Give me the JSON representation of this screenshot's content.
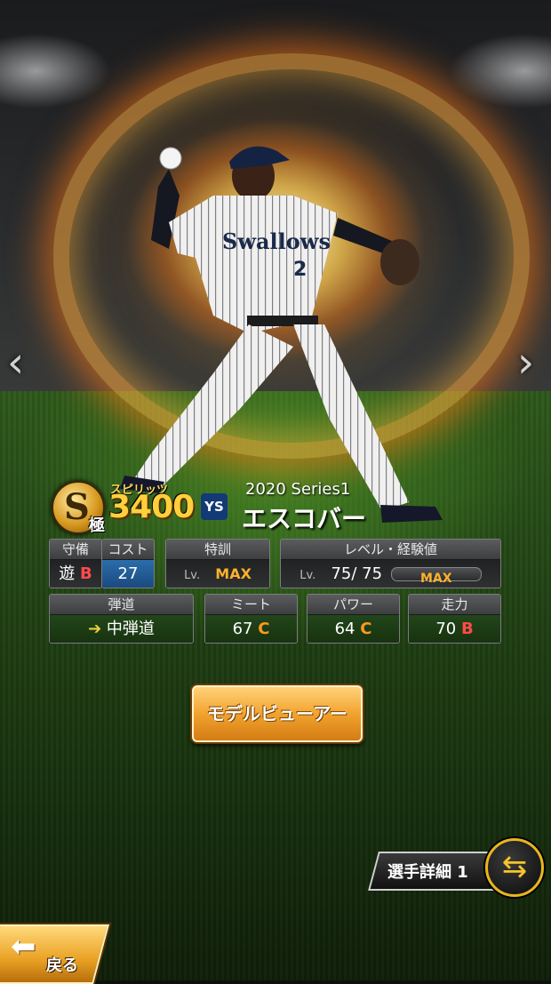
{
  "player": {
    "series": "2020 Series1",
    "name": "エスコバー",
    "jersey_text": "Swallows",
    "jersey_number": "2",
    "team_logo": "YS"
  },
  "rank": {
    "letter": "S",
    "tier": "極"
  },
  "spirits": {
    "label": "スピリッツ",
    "value": "3400"
  },
  "nav": {
    "prev_arrow": "‹",
    "next_arrow": "›"
  },
  "stats": {
    "defense": {
      "label": "守備",
      "position": "遊",
      "grade": "B"
    },
    "cost": {
      "label": "コスト",
      "value": "27"
    },
    "training": {
      "label": "特訓",
      "lv": "Lv.",
      "value": "MAX"
    },
    "level": {
      "label": "レベル・経験値",
      "lv": "Lv.",
      "current": "75",
      "sep": "/",
      "max": "75",
      "exp_bar": "MAX"
    },
    "trajectory": {
      "label": "弾道",
      "value": "中弾道"
    },
    "meet": {
      "label": "ミート",
      "value": "67",
      "grade": "C"
    },
    "power": {
      "label": "パワー",
      "value": "64",
      "grade": "C"
    },
    "speed": {
      "label": "走力",
      "value": "70",
      "grade": "B"
    }
  },
  "buttons": {
    "model_viewer": "モデルビューアー",
    "player_detail": "選手詳細 1",
    "back": "戻る"
  },
  "icons": {
    "trajectory": "arrow-up-right-icon",
    "swap": "swap-arrows-icon",
    "back": "back-arrow-icon"
  },
  "colors": {
    "accent": "#ffcf3c",
    "grade_c": "#ff9a1e",
    "grade_b": "#ff4b4b",
    "cost_bg": "#2b6dab"
  }
}
